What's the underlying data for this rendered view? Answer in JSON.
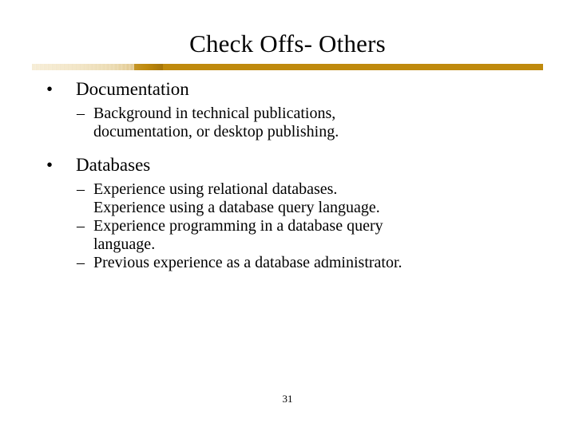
{
  "slide": {
    "title": "Check Offs- Others",
    "page_number": "31",
    "accent_color": "#bf8a0d",
    "texture_color": "#f3e7c8",
    "background_color": "#ffffff",
    "text_color": "#000000",
    "bullet_glyph": "•",
    "dash_glyph": "–",
    "groups": [
      {
        "heading": "Documentation",
        "items": [
          {
            "line1": "Background in technical publications,",
            "line2": "documentation, or desktop publishing."
          }
        ]
      },
      {
        "heading": "Databases",
        "items": [
          {
            "line1": "Experience using relational databases.",
            "line2": "Experience using a database query language."
          },
          {
            "line1": "Experience programming in a database query",
            "line2": "language."
          },
          {
            "line1": "Previous experience as a database administrator.",
            "line2": ""
          }
        ]
      }
    ]
  }
}
